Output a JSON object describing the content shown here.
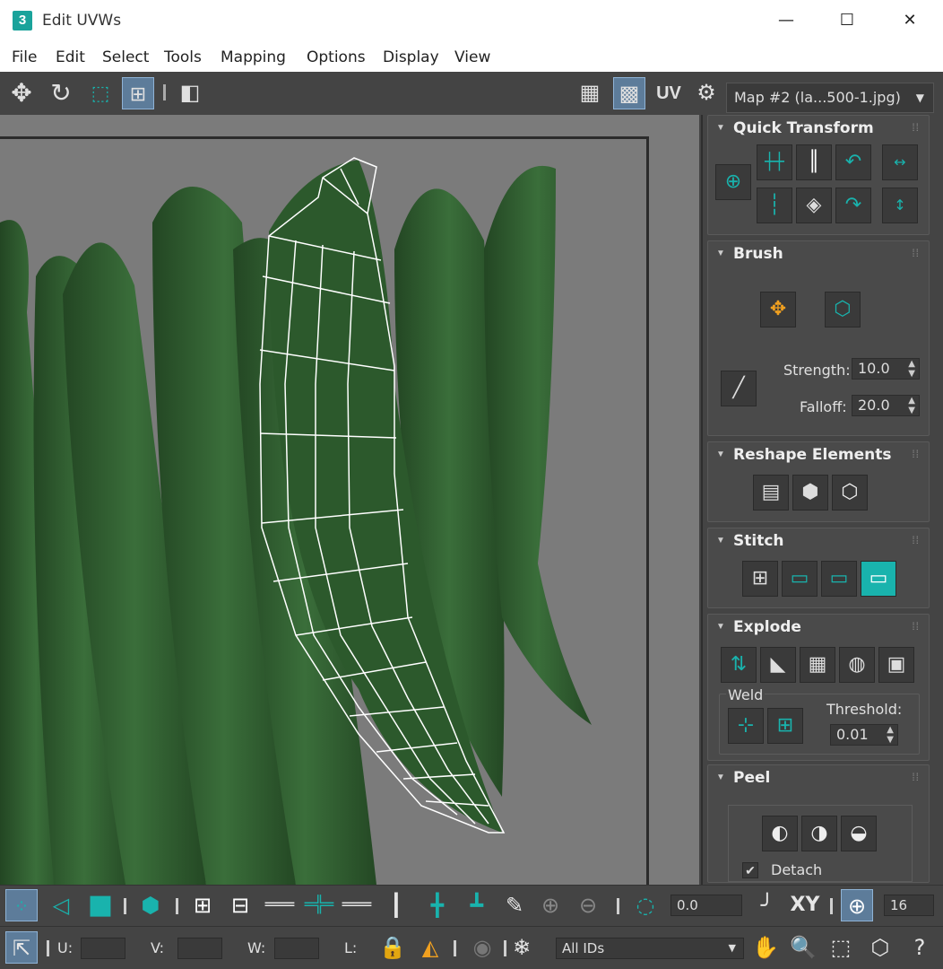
{
  "window": {
    "title": "Edit UVWs",
    "app_icon": "3",
    "controls": {
      "minimize": "—",
      "maximize": "☐",
      "close": "✕"
    }
  },
  "menu": [
    "File",
    "Edit",
    "Select",
    "Tools",
    "Mapping",
    "Options",
    "Display",
    "View"
  ],
  "toolbar": {
    "uv_label": "UV",
    "map_dropdown": "Map #2 (la...500-1.jpg)"
  },
  "panel": {
    "quick_transform": {
      "title": "Quick Transform"
    },
    "brush": {
      "title": "Brush",
      "strength_label": "Strength:",
      "strength_value": "10.0",
      "falloff_label": "Falloff:",
      "falloff_value": "20.0"
    },
    "reshape": {
      "title": "Reshape Elements"
    },
    "stitch": {
      "title": "Stitch"
    },
    "explode": {
      "title": "Explode",
      "weld_label": "Weld",
      "threshold_label": "Threshold:",
      "threshold_value": "0.01"
    },
    "peel": {
      "title": "Peel",
      "detach_label": "Detach",
      "detach_checked": true
    }
  },
  "bottom": {
    "angle_value": "0.0",
    "xy_label": "XY",
    "grid_value": "16",
    "u_label": "U:",
    "v_label": "V:",
    "w_label": "W:",
    "l_label": "L:",
    "ids_dropdown": "All IDs"
  },
  "colors": {
    "accent": "#19b3ad",
    "background": "#444444",
    "viewport": "#7b7b7b",
    "okra": "#2f5a2f"
  }
}
